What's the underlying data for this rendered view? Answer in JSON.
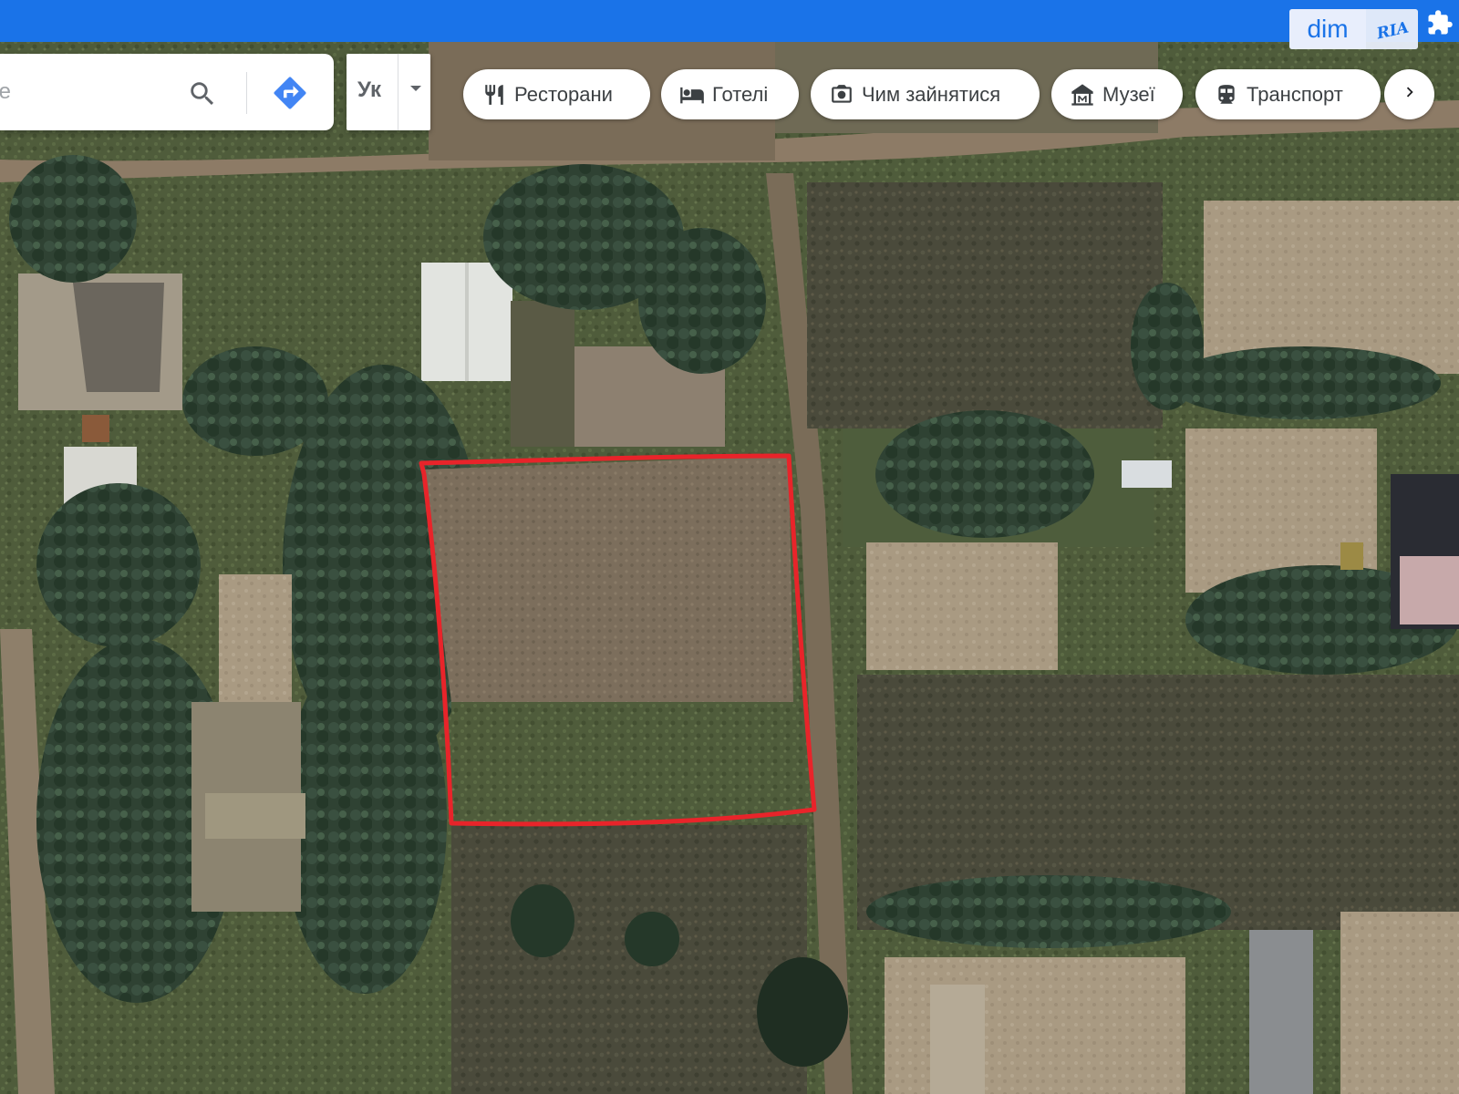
{
  "search": {
    "placeholder": "gle",
    "value": ""
  },
  "language_select": {
    "selected": "Ук"
  },
  "category_chips": [
    {
      "label": "Ресторани",
      "icon": "fork-knife-icon"
    },
    {
      "label": "Готелі",
      "icon": "bed-icon"
    },
    {
      "label": "Чим зайнятися",
      "icon": "camera-icon"
    },
    {
      "label": "Музеї",
      "icon": "museum-icon"
    },
    {
      "label": "Транспорт",
      "icon": "bus-icon"
    }
  ],
  "watermark": {
    "brand_left": "dim",
    "brand_right": "RIA"
  },
  "colors": {
    "topbar": "#1a73e8",
    "plot_outline": "#e8242a",
    "chip_text": "#3c4043",
    "directions": "#4285f4"
  }
}
